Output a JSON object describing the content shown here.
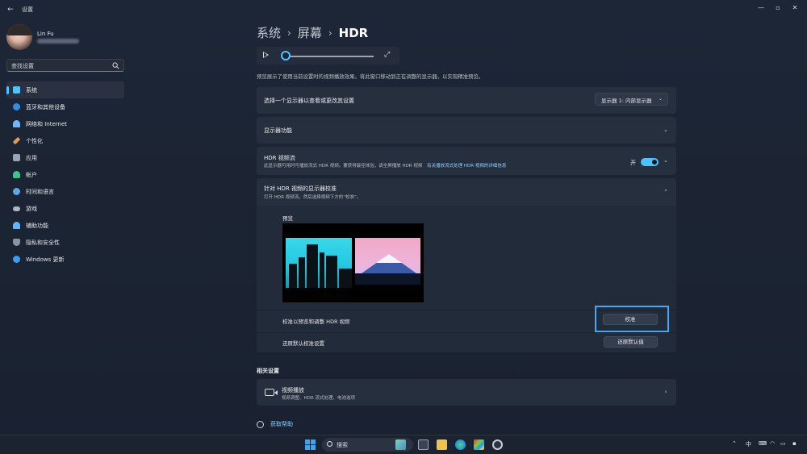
{
  "window": {
    "app_title": "设置"
  },
  "profile": {
    "name": "Lin Fu"
  },
  "search": {
    "placeholder": "查找设置"
  },
  "sidebar": {
    "items": [
      {
        "label": "系统",
        "icon": "monitor-icon",
        "color": "#4cc2ff"
      },
      {
        "label": "蓝牙和其他设备",
        "icon": "bluetooth-icon",
        "color": "#2f8fe0"
      },
      {
        "label": "网络和 Internet",
        "icon": "wifi-icon",
        "color": "#6fb6ff"
      },
      {
        "label": "个性化",
        "icon": "brush-icon",
        "color": "#e29a57"
      },
      {
        "label": "应用",
        "icon": "apps-icon",
        "color": "#9aa3b1"
      },
      {
        "label": "帐户",
        "icon": "person-icon",
        "color": "#3fc38b"
      },
      {
        "label": "时间和语言",
        "icon": "globe-clock-icon",
        "color": "#5aa7ea"
      },
      {
        "label": "游戏",
        "icon": "gamepad-icon",
        "color": "#aeb5c0"
      },
      {
        "label": "辅助功能",
        "icon": "accessibility-icon",
        "color": "#63b3ff"
      },
      {
        "label": "隐私和安全性",
        "icon": "shield-icon",
        "color": "#8a93a3"
      },
      {
        "label": "Windows 更新",
        "icon": "windows-update-icon",
        "color": "#3a9ef0"
      }
    ]
  },
  "breadcrumb": {
    "part1": "系统",
    "part2": "屏幕",
    "current": "HDR",
    "sep": "›"
  },
  "preview": {
    "description": "预览展示了使用当前设置时的视频播放效果。将此窗口移动到正在调整的显示器，以实现精准预览。"
  },
  "display_select": {
    "label": "选择一个显示器以查看或更改其设置",
    "value": "显示器 1: 内部显示器"
  },
  "display_features": {
    "label": "显示器功能"
  },
  "hdr_streaming": {
    "title": "HDR 视频流",
    "subtitle": "此显示器可用时可播放流式 HDR 视频。要获得最佳体验，请全屏播放 HDR 视频",
    "link": "有关播放流式处理 HDR 视频的详细信息",
    "toggle_label": "开",
    "toggle_on": true
  },
  "calibration": {
    "title": "针对 HDR 视频的显示器校准",
    "subtitle": "打开 HDR 视频流，然后选择视频下方的“校准”。",
    "preview_label": "预览",
    "calibrate_label": "校准以预览和调整 HDR 视频",
    "calibrate_button": "校准",
    "reset_label": "还原默认校准设置",
    "reset_button": "还原默认值"
  },
  "related": {
    "title": "相关设置",
    "video_playback_title": "视频播放",
    "video_playback_sub": "视频调整、HDR 流式处理、电池选项"
  },
  "help": {
    "label": "获取帮助"
  },
  "taskbar": {
    "search_label": "搜索",
    "ime": "中"
  },
  "colors": {
    "accent": "#4cc2ff",
    "focus_outline": "#3fa9f5"
  }
}
